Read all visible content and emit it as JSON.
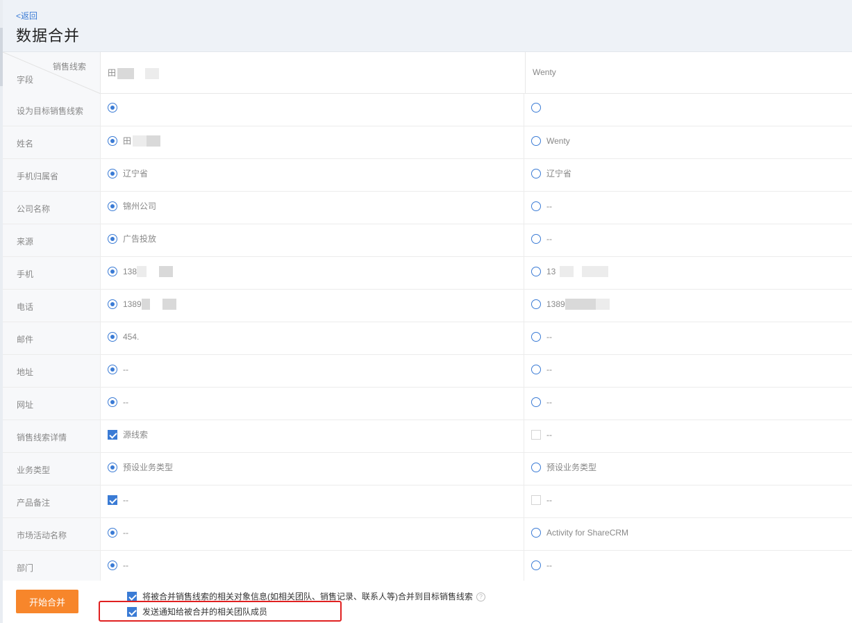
{
  "header": {
    "back_label": "<返回",
    "title": "数据合并"
  },
  "table": {
    "corner_top": "销售线索",
    "corner_bottom": "字段",
    "col1_name": "田",
    "col2_name": "Wenty",
    "rows": [
      {
        "label": "设为目标销售线索",
        "control": "radio",
        "c1_selected": true,
        "c1_value": "",
        "c2_value": ""
      },
      {
        "label": "姓名",
        "control": "radio",
        "c1_selected": true,
        "c1_value": "田",
        "c2_value": "Wenty"
      },
      {
        "label": "手机归属省",
        "control": "radio",
        "c1_selected": true,
        "c1_value": "辽宁省",
        "c2_value": "辽宁省"
      },
      {
        "label": "公司名称",
        "control": "radio",
        "c1_selected": true,
        "c1_value": "锦州公司",
        "c2_value": "--"
      },
      {
        "label": "来源",
        "control": "radio",
        "c1_selected": true,
        "c1_value": "广告投放",
        "c2_value": "--"
      },
      {
        "label": "手机",
        "control": "radio",
        "c1_selected": true,
        "c1_value": "138",
        "c2_value": "13"
      },
      {
        "label": "电话",
        "control": "radio",
        "c1_selected": true,
        "c1_value": "1389",
        "c2_value": "1389"
      },
      {
        "label": "邮件",
        "control": "radio",
        "c1_selected": true,
        "c1_value": "454.",
        "c2_value": "--"
      },
      {
        "label": "地址",
        "control": "radio",
        "c1_selected": true,
        "c1_value": "--",
        "c2_value": "--"
      },
      {
        "label": "网址",
        "control": "radio",
        "c1_selected": true,
        "c1_value": "--",
        "c2_value": "--"
      },
      {
        "label": "销售线索详情",
        "control": "checkbox",
        "c1_selected": true,
        "c1_value": "源线索",
        "c2_value": "--"
      },
      {
        "label": "业务类型",
        "control": "radio",
        "c1_selected": true,
        "c1_value": "预设业务类型",
        "c2_value": "预设业务类型"
      },
      {
        "label": "产品备注",
        "control": "checkbox",
        "c1_selected": true,
        "c1_value": "--",
        "c2_value": "--"
      },
      {
        "label": "市场活动名称",
        "control": "radio",
        "c1_selected": true,
        "c1_value": "--",
        "c2_value": "Activity for ShareCRM"
      },
      {
        "label": "部门",
        "control": "radio",
        "c1_selected": true,
        "c1_value": "--",
        "c2_value": "--"
      }
    ]
  },
  "footer": {
    "merge_button": "开始合并",
    "option1_label": "将被合并销售线索的相关对象信息(如相关团队、销售记录、联系人等)合并到目标销售线索",
    "option1_checked": true,
    "help_glyph": "?",
    "option2_label": "发送通知给被合并的相关团队成员",
    "option2_checked": true
  },
  "colors": {
    "accent": "#3a7bd5",
    "button": "#f7862b",
    "highlight": "#e02020"
  }
}
